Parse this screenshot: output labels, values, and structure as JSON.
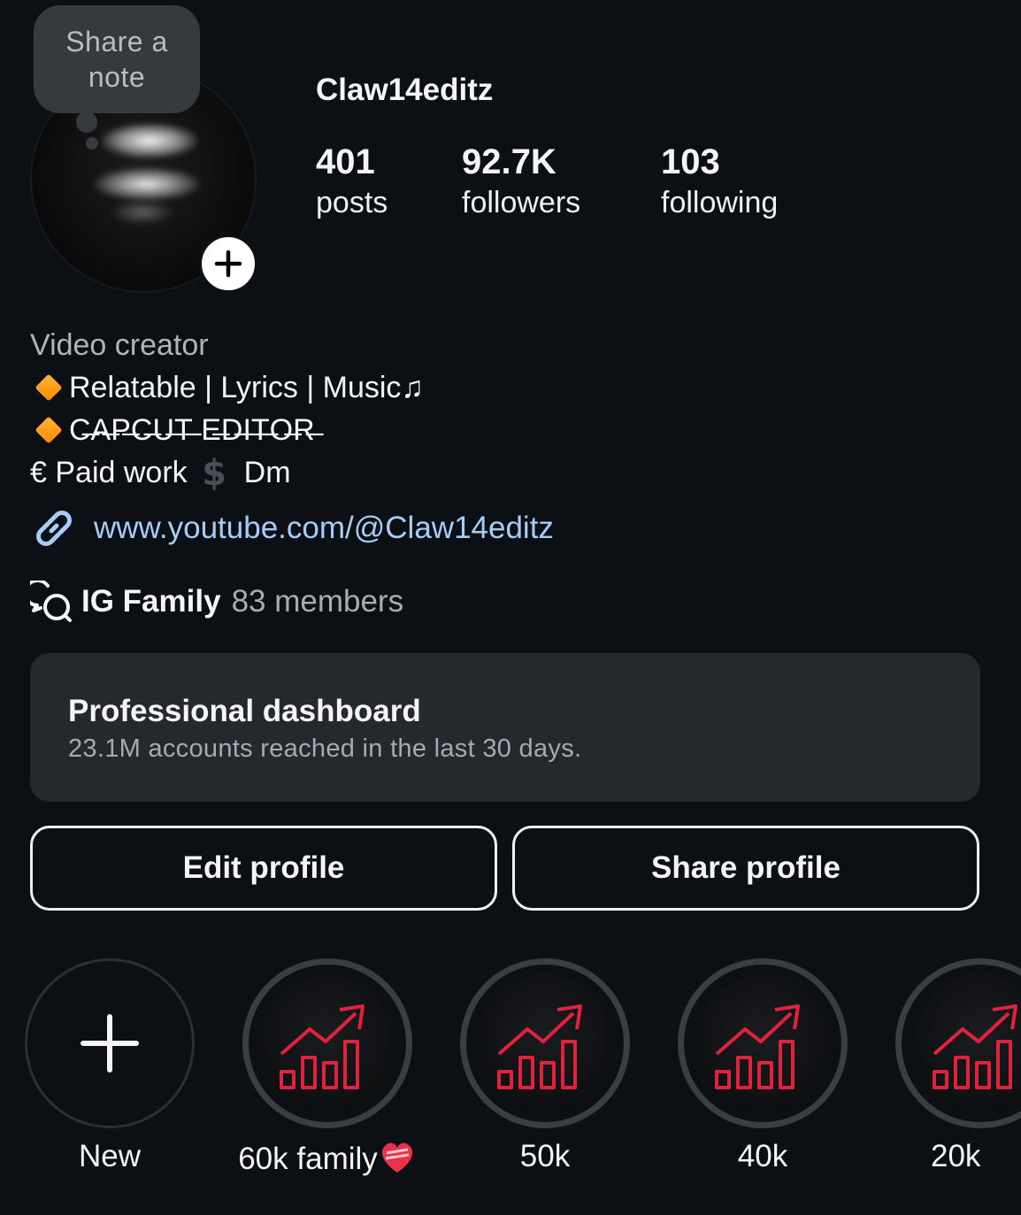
{
  "note": {
    "text": "Share a note"
  },
  "profile": {
    "username": "Claw14editz",
    "stats": [
      {
        "value": "401",
        "label": "posts"
      },
      {
        "value": "92.7K",
        "label": "followers"
      },
      {
        "value": "103",
        "label": "following"
      }
    ]
  },
  "bio": {
    "category": "Video creator",
    "line1": "Relatable | Lyrics | Music♫",
    "line2": "C̶A̶P̶C̶U̶T̶ E̶D̶I̶T̶O̶R̶",
    "line3_prefix": "€ Paid work",
    "line3_suffix": "Dm",
    "link": "www.youtube.com/@Claw14editz"
  },
  "channel": {
    "name": "IG Family",
    "members": "83 members"
  },
  "dashboard": {
    "title": "Professional dashboard",
    "subtitle": "23.1M accounts reached in the last 30 days."
  },
  "buttons": {
    "edit": "Edit profile",
    "share": "Share profile"
  },
  "highlights": [
    {
      "label": "New"
    },
    {
      "label": "60k family"
    },
    {
      "label": "50k"
    },
    {
      "label": "40k"
    },
    {
      "label": "20k"
    }
  ],
  "colors": {
    "background": "#0c1014",
    "link": "#a6cdf7",
    "highlight_icon": "#e0233c",
    "card": "#25292e"
  },
  "icons": {
    "add_story": "plus-icon",
    "link": "link-icon",
    "channel": "chat-bubbles-icon",
    "highlight": "chart-up-icon",
    "heart": "mending-heart-icon"
  }
}
